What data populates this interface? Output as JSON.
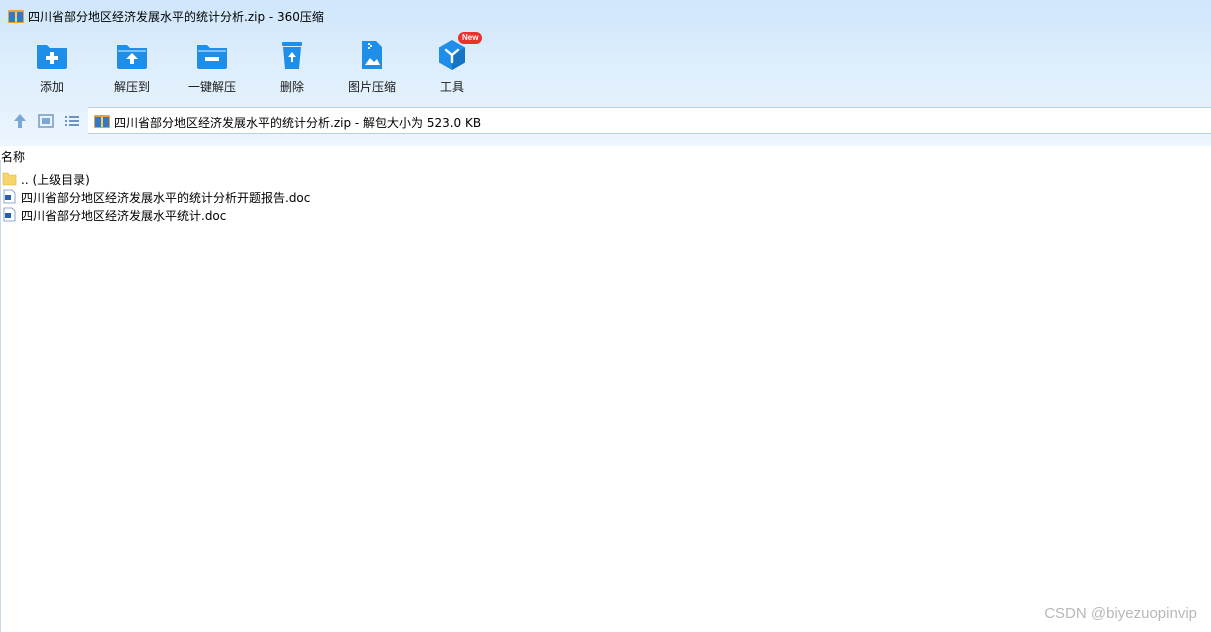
{
  "window": {
    "title": "四川省部分地区经济发展水平的统计分析.zip - 360压缩"
  },
  "toolbar": {
    "items": [
      {
        "label": "添加",
        "icon": "folder-add-icon"
      },
      {
        "label": "解压到",
        "icon": "folder-extract-icon"
      },
      {
        "label": "一键解压",
        "icon": "one-click-extract-icon"
      },
      {
        "label": "删除",
        "icon": "recycle-bin-icon"
      },
      {
        "label": "图片压缩",
        "icon": "image-compress-icon"
      },
      {
        "label": "工具",
        "icon": "tools-cube-icon",
        "badge": "New"
      }
    ]
  },
  "navbar": {
    "address": "四川省部分地区经济发展水平的统计分析.zip - 解包大小为 523.0 KB"
  },
  "list": {
    "column_name": "名称",
    "rows": [
      {
        "label": ".. (上级目录)",
        "icon": "folder-icon"
      },
      {
        "label": "四川省部分地区经济发展水平的统计分析开题报告.doc",
        "icon": "word-doc-icon"
      },
      {
        "label": "四川省部分地区经济发展水平统计.doc",
        "icon": "word-doc-icon"
      }
    ]
  },
  "watermark": "CSDN @biyezuopinvip",
  "colors": {
    "accent": "#1f8ee8",
    "chrome": "#dcedfc",
    "badge": "#e8322b"
  }
}
